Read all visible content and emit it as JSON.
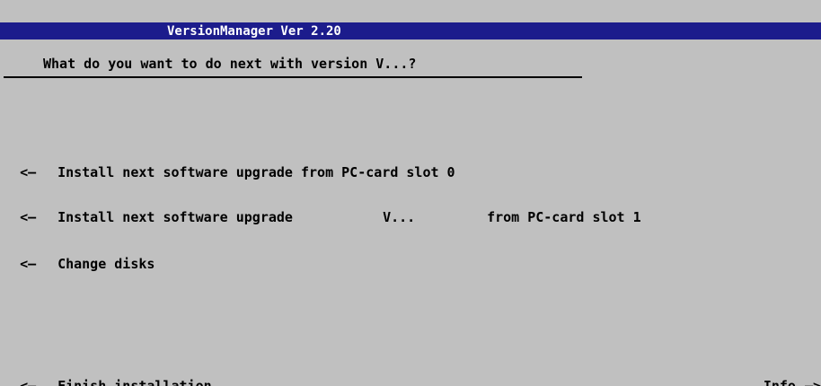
{
  "titlebar": {
    "title": "VersionManager Ver 2.20"
  },
  "prompt": {
    "question": "What do you want to do next with version V...?"
  },
  "softkeys_left": [
    {
      "arrow": "<—",
      "label": "Install next software upgrade from PC-card slot 0"
    },
    {
      "arrow": "<—",
      "parts": [
        "Install next software upgrade",
        "V...",
        "from PC-card slot 1"
      ]
    },
    {
      "arrow": "<—",
      "label": "Change disks"
    },
    {
      "arrow": "<—",
      "label": "Finish installation"
    }
  ],
  "softkey_right": {
    "label": "Info",
    "arrow": "—>"
  },
  "colors": {
    "background": "#c0c0c0",
    "titlebar": "#1c1c8c",
    "title_text": "#ffffff",
    "text": "#000000"
  }
}
